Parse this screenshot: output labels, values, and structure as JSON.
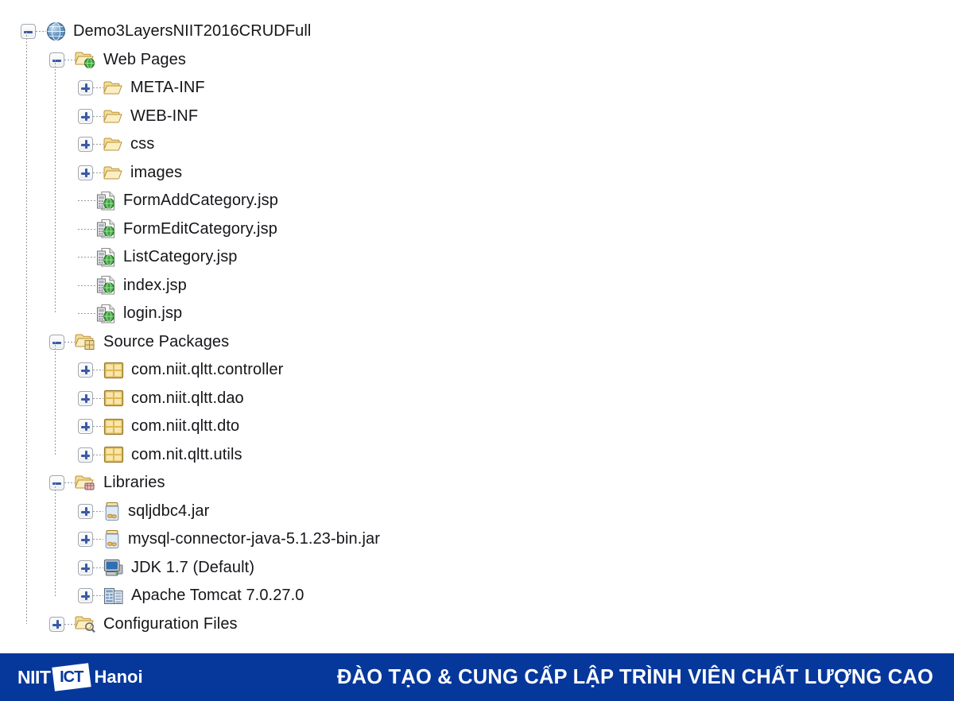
{
  "tree": {
    "nodes": [
      {
        "depth": 0,
        "state": "expanded",
        "icon": "web-globe-icon",
        "label": "Demo3LayersNIIT2016CRUDFull"
      },
      {
        "depth": 1,
        "state": "expanded",
        "icon": "web-pages-folder-icon",
        "label": "Web Pages"
      },
      {
        "depth": 2,
        "state": "collapsed",
        "icon": "folder-icon",
        "label": "META-INF"
      },
      {
        "depth": 2,
        "state": "collapsed",
        "icon": "folder-icon",
        "label": "WEB-INF"
      },
      {
        "depth": 2,
        "state": "collapsed",
        "icon": "folder-icon",
        "label": "css"
      },
      {
        "depth": 2,
        "state": "collapsed",
        "icon": "folder-icon",
        "label": "images"
      },
      {
        "depth": 2,
        "state": "leaf",
        "icon": "jsp-file-icon",
        "label": "FormAddCategory.jsp"
      },
      {
        "depth": 2,
        "state": "leaf",
        "icon": "jsp-file-icon",
        "label": "FormEditCategory.jsp"
      },
      {
        "depth": 2,
        "state": "leaf",
        "icon": "jsp-file-icon",
        "label": "ListCategory.jsp"
      },
      {
        "depth": 2,
        "state": "leaf",
        "icon": "jsp-file-icon",
        "label": "index.jsp"
      },
      {
        "depth": 2,
        "state": "leaf",
        "icon": "jsp-file-icon",
        "label": "login.jsp"
      },
      {
        "depth": 1,
        "state": "expanded",
        "icon": "source-packages-folder-icon",
        "label": "Source Packages"
      },
      {
        "depth": 2,
        "state": "collapsed",
        "icon": "package-icon",
        "label": "com.niit.qltt.controller"
      },
      {
        "depth": 2,
        "state": "collapsed",
        "icon": "package-icon",
        "label": "com.niit.qltt.dao"
      },
      {
        "depth": 2,
        "state": "collapsed",
        "icon": "package-icon",
        "label": "com.niit.qltt.dto"
      },
      {
        "depth": 2,
        "state": "collapsed",
        "icon": "package-icon",
        "label": "com.nit.qltt.utils"
      },
      {
        "depth": 1,
        "state": "expanded",
        "icon": "libraries-folder-icon",
        "label": "Libraries"
      },
      {
        "depth": 2,
        "state": "collapsed",
        "icon": "jar-icon",
        "label": "sqljdbc4.jar"
      },
      {
        "depth": 2,
        "state": "collapsed",
        "icon": "jar-icon",
        "label": "mysql-connector-java-5.1.23-bin.jar"
      },
      {
        "depth": 2,
        "state": "collapsed",
        "icon": "jdk-icon",
        "label": "JDK 1.7 (Default)"
      },
      {
        "depth": 2,
        "state": "collapsed",
        "icon": "server-icon",
        "label": "Apache Tomcat 7.0.27.0"
      },
      {
        "depth": 1,
        "state": "collapsed",
        "icon": "config-folder-icon",
        "label": "Configuration Files"
      }
    ]
  },
  "banner": {
    "logo_niit": "NIIT",
    "logo_mark": "ICT",
    "logo_hanoi": "Hanoi",
    "tagline": "ĐÀO TẠO & CUNG CẤP LẬP TRÌNH VIÊN CHẤT LƯỢNG CAO",
    "background_color": "#06389b",
    "text_color": "#ffffff"
  }
}
